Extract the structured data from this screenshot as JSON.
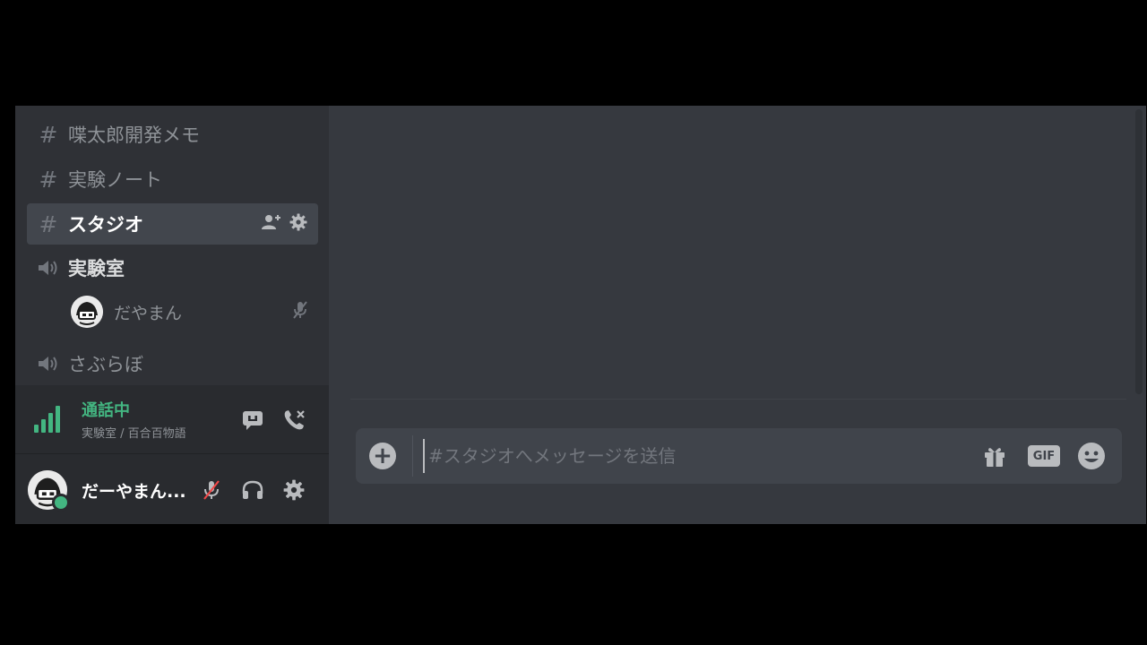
{
  "channels": [
    {
      "type": "text",
      "name": "喋太郎開発メモ"
    },
    {
      "type": "text",
      "name": "実験ノート"
    },
    {
      "type": "text",
      "name": "スタジオ",
      "selected": true
    },
    {
      "type": "voice",
      "name": "実験室"
    },
    {
      "type": "voice",
      "name": "さぶらぼ"
    }
  ],
  "text_channel_hash": "#",
  "voice_user": {
    "name": "だやまん"
  },
  "voice_panel": {
    "status": "通話中",
    "location": "実験室 / 百合百物語"
  },
  "user_panel": {
    "username": "だーやまん..."
  },
  "composer": {
    "placeholder": "#スタジオへメッセージを送信",
    "plus_label": "+",
    "gif_label": "GIF"
  },
  "colors": {
    "online": "#43b581",
    "sidebar_bg": "#2f3136",
    "main_bg": "#36393f"
  },
  "icons": {
    "invite": "add-user-icon",
    "settings": "gear-icon",
    "speaker": "speaker-icon",
    "mic_muted": "mic-muted-icon",
    "headphones": "headphones-icon",
    "signal": "signal-icon",
    "video": "screen-share-icon",
    "disconnect": "disconnect-call-icon",
    "gift": "gift-icon",
    "gif": "gif-icon",
    "emoji": "emoji-icon"
  }
}
